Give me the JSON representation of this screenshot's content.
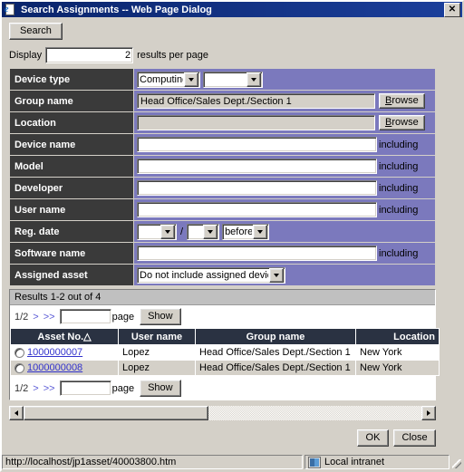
{
  "window": {
    "title": "Search Assignments -- Web Page Dialog",
    "icon": "ie-page-icon",
    "close_label": "✕"
  },
  "toolbar": {
    "search_label": "Search"
  },
  "display_row": {
    "prefix": "Display",
    "value": "2",
    "suffix": "results per page"
  },
  "criteria": [
    {
      "label": "Device type",
      "type": "two-selects",
      "select1": "Computing",
      "select2": ""
    },
    {
      "label": "Group name",
      "type": "readonly-browse",
      "value": "Head Office/Sales Dept./Section 1",
      "browse_label": "Browse",
      "browse_accesskey": "B"
    },
    {
      "label": "Location",
      "type": "readonly-browse",
      "value": "",
      "browse_label": "Browse",
      "browse_accesskey": "B"
    },
    {
      "label": "Device name",
      "type": "text-including",
      "value": "",
      "including": "including"
    },
    {
      "label": "Model",
      "type": "text-including",
      "value": "",
      "including": "including"
    },
    {
      "label": "Developer",
      "type": "text-including",
      "value": "",
      "including": "including"
    },
    {
      "label": "User name",
      "type": "text-including",
      "value": "",
      "including": "including"
    },
    {
      "label": "Reg. date",
      "type": "date",
      "year": "",
      "separator": "/",
      "month": "",
      "comparator": "before"
    },
    {
      "label": "Software name",
      "type": "text-including",
      "value": "",
      "including": "including"
    },
    {
      "label": "Assigned asset",
      "type": "select",
      "select1": "Do not include assigned devices"
    }
  ],
  "results": {
    "summary": "Results 1-2 out of 4",
    "pager": {
      "page_indicator": "1/2",
      "next_label": ">",
      "last_label": ">>",
      "page_input_value": "",
      "page_label": "page",
      "show_label": "Show"
    },
    "columns": [
      {
        "label": "Asset No.",
        "sort": "△",
        "align": "center"
      },
      {
        "label": "User name",
        "sort": "",
        "align": "center"
      },
      {
        "label": "Group name",
        "sort": "",
        "align": "center"
      },
      {
        "label": "Location",
        "sort": "",
        "align": "right"
      }
    ],
    "rows": [
      {
        "asset_no": "1000000007",
        "user_name": "Lopez",
        "group_name": "Head Office/Sales Dept./Section 1",
        "location": "New York"
      },
      {
        "asset_no": "1000000008",
        "user_name": "Lopez",
        "group_name": "Head Office/Sales Dept./Section 1",
        "location": "New York"
      }
    ]
  },
  "footer": {
    "ok_label": "OK",
    "close_label": "Close"
  },
  "statusbar": {
    "url": "http://localhost/jp1asset/40003800.htm",
    "zone": "Local intranet",
    "zone_icon": "intranet-zone-icon"
  },
  "colors": {
    "titlebar": "#0a246a",
    "label_cell": "#3a3a3a",
    "value_cell": "#7b79bd",
    "grid_header": "#2a3242",
    "dialog_face": "#d4d0c8",
    "link": "#3333cc",
    "pager_link": "#5a5ad6"
  }
}
